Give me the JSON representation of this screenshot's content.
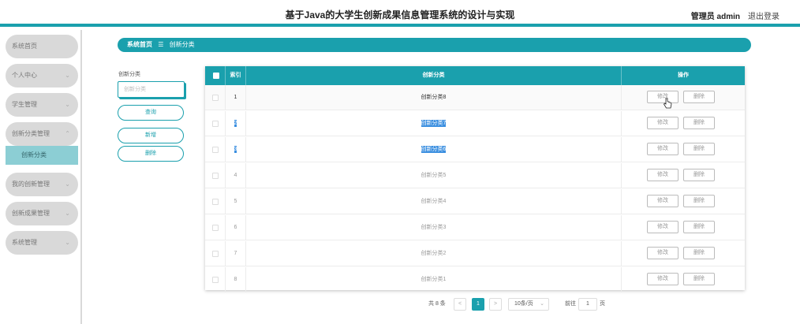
{
  "header": {
    "title": "基于Java的大学生创新成果信息管理系统的设计与实现",
    "user": "管理员 admin",
    "logout": "退出登录"
  },
  "sidebar": {
    "items": [
      {
        "label": "系统首页"
      },
      {
        "label": "个人中心",
        "chevron": "⌄"
      },
      {
        "label": "学生管理",
        "chevron": "⌄"
      },
      {
        "label": "创新分类管理",
        "chevron": "⌃"
      },
      {
        "label": "我的创新管理",
        "chevron": "⌄"
      },
      {
        "label": "创新成果管理",
        "chevron": "⌄"
      },
      {
        "label": "系统管理",
        "chevron": "⌄"
      }
    ],
    "sub_item": "创新分类"
  },
  "breadcrumb": {
    "home": "系统首页",
    "separator": "☰",
    "current": "创新分类"
  },
  "search": {
    "label": "创新分类",
    "placeholder": "创新分类",
    "query_button": "查询",
    "add_button": "新增",
    "delete_button": "删除"
  },
  "table": {
    "headers": {
      "index": "索引",
      "category": "创新分类",
      "actions": "操作"
    },
    "rows": [
      {
        "index": "1",
        "category": "创新分类8"
      },
      {
        "index": "2",
        "category": "创新分类7"
      },
      {
        "index": "3",
        "category": "创新分类6"
      },
      {
        "index": "4",
        "category": "创新分类5"
      },
      {
        "index": "5",
        "category": "创新分类4"
      },
      {
        "index": "6",
        "category": "创新分类3"
      },
      {
        "index": "7",
        "category": "创新分类2"
      },
      {
        "index": "8",
        "category": "创新分类1"
      }
    ],
    "edit_label": "修改",
    "delete_label": "删除"
  },
  "pagination": {
    "total": "共 8 条",
    "prev": "<",
    "current_page": "1",
    "next": ">",
    "page_size": "10条/页",
    "page_size_chevron": "⌄",
    "goto_label": "前往",
    "goto_value": "1",
    "goto_suffix": "页"
  },
  "colors": {
    "accent": "#1aa0ad",
    "selection": "#3b8fe0",
    "sidebar_item": "#d9d9d9",
    "sidebar_active": "#8cced4"
  }
}
